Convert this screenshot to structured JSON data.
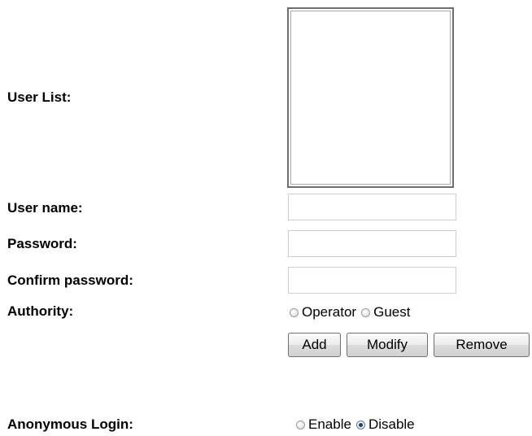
{
  "labels": {
    "user_list": "User List:",
    "user_name": "User name:",
    "password": "Password:",
    "confirm_password": "Confirm password:",
    "authority": "Authority:",
    "anonymous_login": "Anonymous Login:"
  },
  "fields": {
    "user_name": {
      "value": "",
      "placeholder": ""
    },
    "password": {
      "value": "",
      "placeholder": ""
    },
    "confirm_password": {
      "value": "",
      "placeholder": ""
    }
  },
  "user_list": {
    "items": []
  },
  "authority": {
    "options": [
      "Operator",
      "Guest"
    ],
    "selected": null
  },
  "buttons": {
    "add": "Add",
    "modify": "Modify",
    "remove": "Remove"
  },
  "anonymous_login": {
    "options": [
      "Enable",
      "Disable"
    ],
    "selected": "Disable"
  },
  "colors": {
    "background": "#ffffff",
    "text": "#000000",
    "field_border": "#cfcfcf",
    "listbox_border": "#6e6e6e",
    "radio_selected": "#1b3e6a"
  }
}
